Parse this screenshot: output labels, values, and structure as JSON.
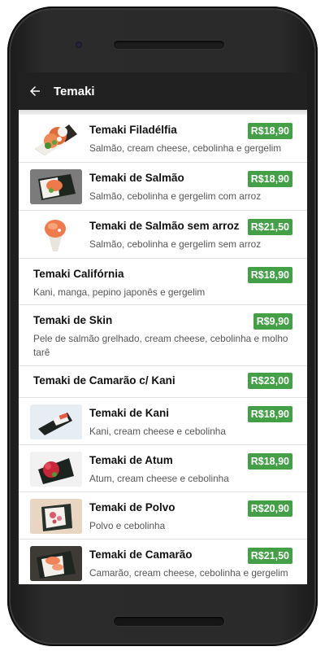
{
  "appbar": {
    "title": "Temaki",
    "back_icon": "arrow-back-icon"
  },
  "colors": {
    "appbar": "#212121",
    "price_badge": "#43a047",
    "divider": "#e0e0e0"
  },
  "items": [
    {
      "name": "Temaki Filadélfia",
      "price": "R$18,90",
      "description": "Salmão, cream cheese, cebolinha e gergelim",
      "image": "temaki-filadelfia-photo"
    },
    {
      "name": "Temaki de Salmão",
      "price": "R$18,90",
      "description": "Salmão, cebolinha e gergelim com arroz",
      "image": "temaki-salmao-photo"
    },
    {
      "name": "Temaki de Salmão sem arroz",
      "price": "R$21,50",
      "description": "Salmão, cebolinha e gergelim sem arroz",
      "image": "temaki-salmao-sem-arroz-photo"
    },
    {
      "name": "Temaki Califórnia",
      "price": "R$18,90",
      "description": "Kani, manga, pepino japonês e gergelim"
    },
    {
      "name": "Temaki de Skin",
      "price": "R$9,90",
      "description": "Pele de salmão grelhado, cream cheese, cebolinha e molho tarê"
    },
    {
      "name": "Temaki de Camarão c/ Kani",
      "price": "R$23,00",
      "description": ""
    },
    {
      "name": "Temaki de Kani",
      "price": "R$18,90",
      "description": "Kani, cream cheese e cebolinha",
      "image": "temaki-kani-photo"
    },
    {
      "name": "Temaki de Atum",
      "price": "R$18,90",
      "description": "Atum, cream cheese e cebolinha",
      "image": "temaki-atum-photo"
    },
    {
      "name": "Temaki de Polvo",
      "price": "R$20,90",
      "description": "Polvo e cebolinha",
      "image": "temaki-polvo-photo"
    },
    {
      "name": "Temaki de Camarão",
      "price": "R$21,50",
      "description": "Camarão, cream cheese, cebolinha e gergelim",
      "image": "temaki-camarao-photo"
    }
  ]
}
